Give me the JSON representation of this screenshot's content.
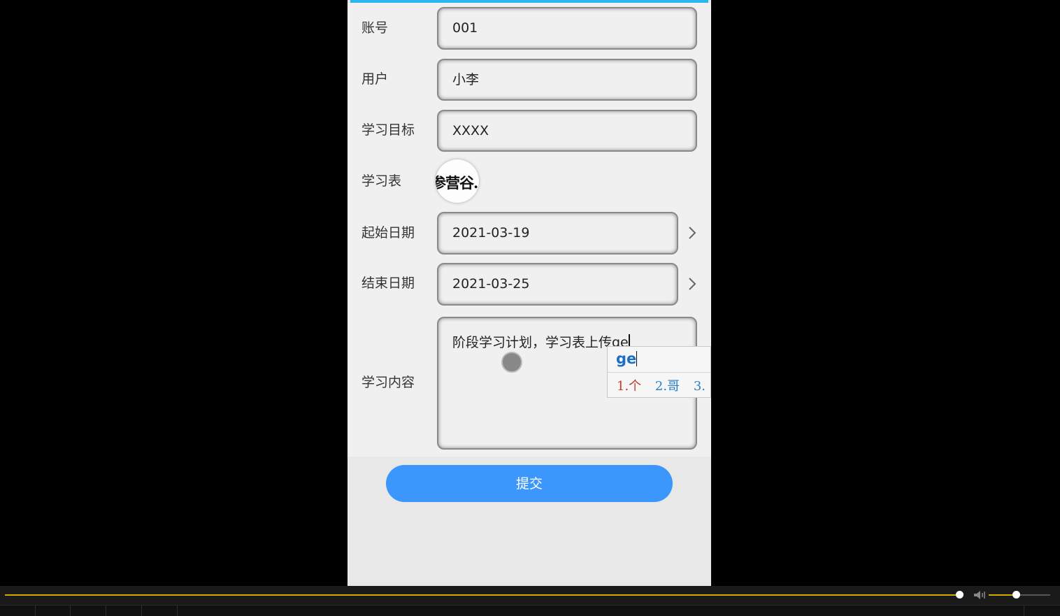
{
  "form": {
    "account": {
      "label": "账号",
      "value": "001"
    },
    "user": {
      "label": "用户",
      "value": "小李"
    },
    "goal": {
      "label": "学习目标",
      "value": "XXXX"
    },
    "sheet": {
      "label": "学习表",
      "image_text": "参营谷."
    },
    "start_date": {
      "label": "起始日期",
      "value": "2021-03-19"
    },
    "end_date": {
      "label": "结束日期",
      "value": "2021-03-25"
    },
    "content": {
      "label": "学习内容",
      "value": "阶段学习计划，学习表上传ge"
    }
  },
  "ime": {
    "composition": "ge",
    "candidates": [
      "1.个",
      "2.哥",
      "3."
    ]
  },
  "submit_label": "提交",
  "player": {
    "progress": 0.905,
    "volume": 0.45
  },
  "colors": {
    "accent_bar": "#2bb7ee",
    "submit_button": "#3c97fc",
    "progress": "#d4a900"
  }
}
